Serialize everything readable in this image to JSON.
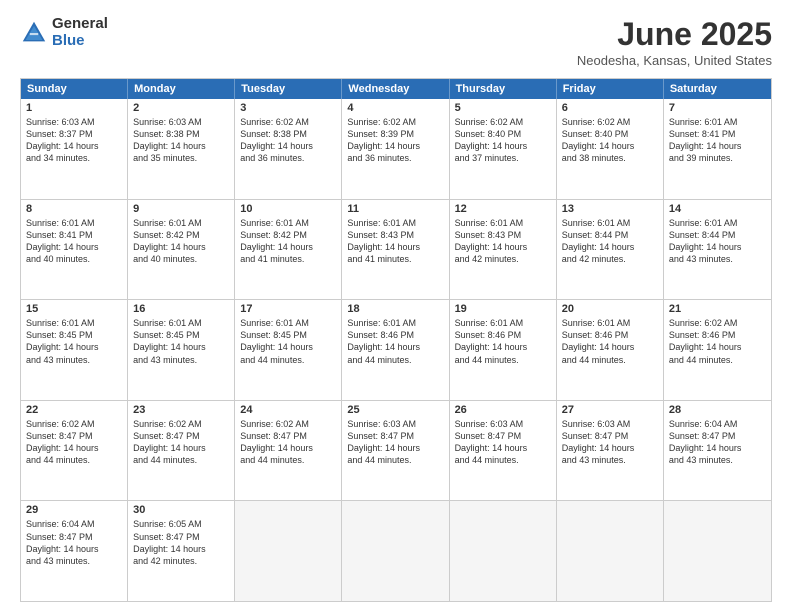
{
  "logo": {
    "general": "General",
    "blue": "Blue"
  },
  "title": "June 2025",
  "location": "Neodesha, Kansas, United States",
  "headers": [
    "Sunday",
    "Monday",
    "Tuesday",
    "Wednesday",
    "Thursday",
    "Friday",
    "Saturday"
  ],
  "rows": [
    [
      {
        "day": "1",
        "lines": [
          "Sunrise: 6:03 AM",
          "Sunset: 8:37 PM",
          "Daylight: 14 hours",
          "and 34 minutes."
        ]
      },
      {
        "day": "2",
        "lines": [
          "Sunrise: 6:03 AM",
          "Sunset: 8:38 PM",
          "Daylight: 14 hours",
          "and 35 minutes."
        ]
      },
      {
        "day": "3",
        "lines": [
          "Sunrise: 6:02 AM",
          "Sunset: 8:38 PM",
          "Daylight: 14 hours",
          "and 36 minutes."
        ]
      },
      {
        "day": "4",
        "lines": [
          "Sunrise: 6:02 AM",
          "Sunset: 8:39 PM",
          "Daylight: 14 hours",
          "and 36 minutes."
        ]
      },
      {
        "day": "5",
        "lines": [
          "Sunrise: 6:02 AM",
          "Sunset: 8:40 PM",
          "Daylight: 14 hours",
          "and 37 minutes."
        ]
      },
      {
        "day": "6",
        "lines": [
          "Sunrise: 6:02 AM",
          "Sunset: 8:40 PM",
          "Daylight: 14 hours",
          "and 38 minutes."
        ]
      },
      {
        "day": "7",
        "lines": [
          "Sunrise: 6:01 AM",
          "Sunset: 8:41 PM",
          "Daylight: 14 hours",
          "and 39 minutes."
        ]
      }
    ],
    [
      {
        "day": "8",
        "lines": [
          "Sunrise: 6:01 AM",
          "Sunset: 8:41 PM",
          "Daylight: 14 hours",
          "and 40 minutes."
        ]
      },
      {
        "day": "9",
        "lines": [
          "Sunrise: 6:01 AM",
          "Sunset: 8:42 PM",
          "Daylight: 14 hours",
          "and 40 minutes."
        ]
      },
      {
        "day": "10",
        "lines": [
          "Sunrise: 6:01 AM",
          "Sunset: 8:42 PM",
          "Daylight: 14 hours",
          "and 41 minutes."
        ]
      },
      {
        "day": "11",
        "lines": [
          "Sunrise: 6:01 AM",
          "Sunset: 8:43 PM",
          "Daylight: 14 hours",
          "and 41 minutes."
        ]
      },
      {
        "day": "12",
        "lines": [
          "Sunrise: 6:01 AM",
          "Sunset: 8:43 PM",
          "Daylight: 14 hours",
          "and 42 minutes."
        ]
      },
      {
        "day": "13",
        "lines": [
          "Sunrise: 6:01 AM",
          "Sunset: 8:44 PM",
          "Daylight: 14 hours",
          "and 42 minutes."
        ]
      },
      {
        "day": "14",
        "lines": [
          "Sunrise: 6:01 AM",
          "Sunset: 8:44 PM",
          "Daylight: 14 hours",
          "and 43 minutes."
        ]
      }
    ],
    [
      {
        "day": "15",
        "lines": [
          "Sunrise: 6:01 AM",
          "Sunset: 8:45 PM",
          "Daylight: 14 hours",
          "and 43 minutes."
        ]
      },
      {
        "day": "16",
        "lines": [
          "Sunrise: 6:01 AM",
          "Sunset: 8:45 PM",
          "Daylight: 14 hours",
          "and 43 minutes."
        ]
      },
      {
        "day": "17",
        "lines": [
          "Sunrise: 6:01 AM",
          "Sunset: 8:45 PM",
          "Daylight: 14 hours",
          "and 44 minutes."
        ]
      },
      {
        "day": "18",
        "lines": [
          "Sunrise: 6:01 AM",
          "Sunset: 8:46 PM",
          "Daylight: 14 hours",
          "and 44 minutes."
        ]
      },
      {
        "day": "19",
        "lines": [
          "Sunrise: 6:01 AM",
          "Sunset: 8:46 PM",
          "Daylight: 14 hours",
          "and 44 minutes."
        ]
      },
      {
        "day": "20",
        "lines": [
          "Sunrise: 6:01 AM",
          "Sunset: 8:46 PM",
          "Daylight: 14 hours",
          "and 44 minutes."
        ]
      },
      {
        "day": "21",
        "lines": [
          "Sunrise: 6:02 AM",
          "Sunset: 8:46 PM",
          "Daylight: 14 hours",
          "and 44 minutes."
        ]
      }
    ],
    [
      {
        "day": "22",
        "lines": [
          "Sunrise: 6:02 AM",
          "Sunset: 8:47 PM",
          "Daylight: 14 hours",
          "and 44 minutes."
        ]
      },
      {
        "day": "23",
        "lines": [
          "Sunrise: 6:02 AM",
          "Sunset: 8:47 PM",
          "Daylight: 14 hours",
          "and 44 minutes."
        ]
      },
      {
        "day": "24",
        "lines": [
          "Sunrise: 6:02 AM",
          "Sunset: 8:47 PM",
          "Daylight: 14 hours",
          "and 44 minutes."
        ]
      },
      {
        "day": "25",
        "lines": [
          "Sunrise: 6:03 AM",
          "Sunset: 8:47 PM",
          "Daylight: 14 hours",
          "and 44 minutes."
        ]
      },
      {
        "day": "26",
        "lines": [
          "Sunrise: 6:03 AM",
          "Sunset: 8:47 PM",
          "Daylight: 14 hours",
          "and 44 minutes."
        ]
      },
      {
        "day": "27",
        "lines": [
          "Sunrise: 6:03 AM",
          "Sunset: 8:47 PM",
          "Daylight: 14 hours",
          "and 43 minutes."
        ]
      },
      {
        "day": "28",
        "lines": [
          "Sunrise: 6:04 AM",
          "Sunset: 8:47 PM",
          "Daylight: 14 hours",
          "and 43 minutes."
        ]
      }
    ],
    [
      {
        "day": "29",
        "lines": [
          "Sunrise: 6:04 AM",
          "Sunset: 8:47 PM",
          "Daylight: 14 hours",
          "and 43 minutes."
        ]
      },
      {
        "day": "30",
        "lines": [
          "Sunrise: 6:05 AM",
          "Sunset: 8:47 PM",
          "Daylight: 14 hours",
          "and 42 minutes."
        ]
      },
      {
        "day": "",
        "lines": []
      },
      {
        "day": "",
        "lines": []
      },
      {
        "day": "",
        "lines": []
      },
      {
        "day": "",
        "lines": []
      },
      {
        "day": "",
        "lines": []
      }
    ]
  ]
}
